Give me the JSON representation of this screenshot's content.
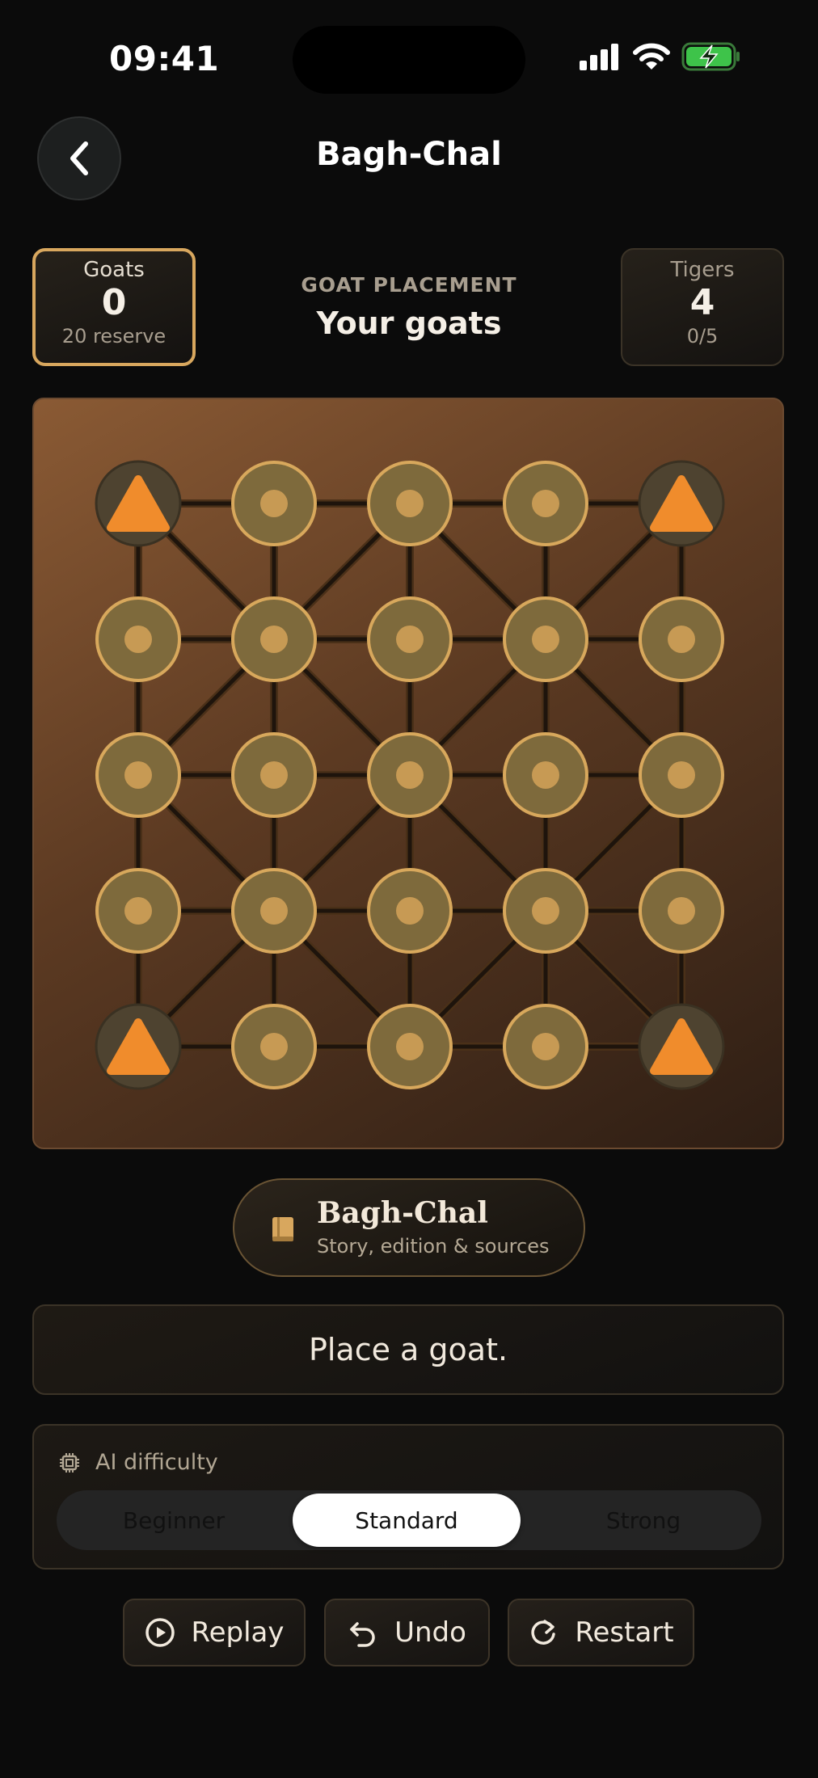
{
  "status": {
    "time": "09:41"
  },
  "nav": {
    "title": "Bagh-Chal"
  },
  "goats": {
    "label": "Goats",
    "count": "0",
    "reserve": "20 reserve"
  },
  "tigers": {
    "label": "Tigers",
    "count": "4",
    "captured": "0/5"
  },
  "phase": {
    "label": "GOAT PLACEMENT",
    "turn": "Your goats"
  },
  "board": {
    "size": 5,
    "tiger_positions": [
      [
        0,
        0
      ],
      [
        0,
        4
      ],
      [
        4,
        0
      ],
      [
        4,
        4
      ]
    ],
    "colors": {
      "tiger": "#f08c2c",
      "empty_fill": "#7e6a3c",
      "empty_ring": "#d8a85c",
      "empty_dot": "#c79a54",
      "line": "#1e140c"
    }
  },
  "lore": {
    "title": "Bagh-Chal",
    "subtitle": "Story, edition & sources",
    "icon": "book-icon"
  },
  "message": "Place a goat.",
  "difficulty": {
    "label": "AI difficulty",
    "icon": "cpu-chip-icon",
    "options": [
      "Beginner",
      "Standard",
      "Strong"
    ],
    "selected": "Standard"
  },
  "actions": {
    "replay": "Replay",
    "undo": "Undo",
    "restart": "Restart"
  },
  "accent": "#d8a75e"
}
